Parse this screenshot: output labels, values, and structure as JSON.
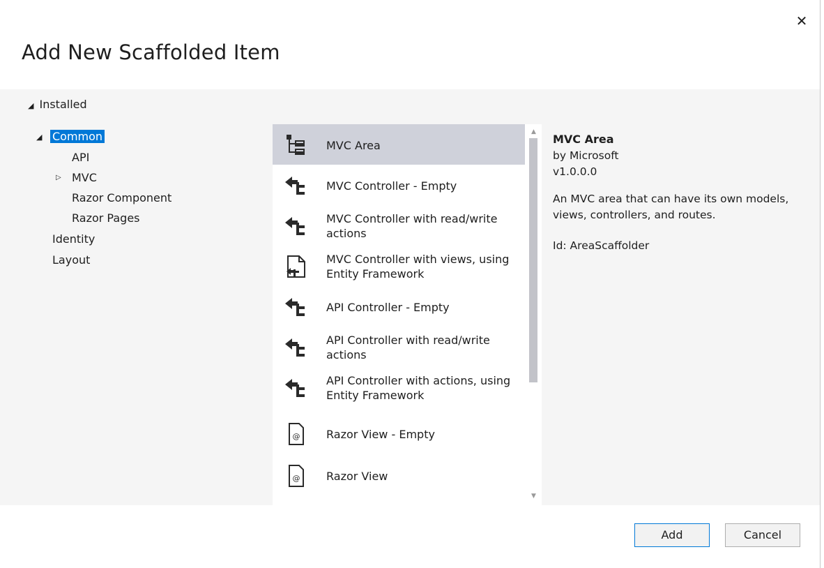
{
  "dialog": {
    "title": "Add New Scaffolded Item",
    "close_label": "✕"
  },
  "tree": {
    "installed_label": "Installed",
    "common_label": "Common",
    "items": [
      {
        "label": "API"
      },
      {
        "label": "MVC"
      },
      {
        "label": "Razor Component"
      },
      {
        "label": "Razor Pages"
      },
      {
        "label": "Identity"
      },
      {
        "label": "Layout"
      }
    ]
  },
  "templates": [
    {
      "line1": "MVC Area",
      "line2": "",
      "icon": "area-icon",
      "selected": true
    },
    {
      "line1": "MVC Controller - Empty",
      "line2": "",
      "icon": "controller-icon"
    },
    {
      "line1": "MVC Controller with read/write",
      "line2": "actions",
      "icon": "controller-icon"
    },
    {
      "line1": "MVC Controller with views, using",
      "line2": "Entity Framework",
      "icon": "controller-views-icon"
    },
    {
      "line1": "API Controller - Empty",
      "line2": "",
      "icon": "controller-icon"
    },
    {
      "line1": "API Controller with read/write",
      "line2": "actions",
      "icon": "controller-icon"
    },
    {
      "line1": "API Controller with actions, using",
      "line2": "Entity Framework",
      "icon": "controller-icon"
    },
    {
      "line1": "Razor View - Empty",
      "line2": "",
      "icon": "razor-view-icon"
    },
    {
      "line1": "Razor View",
      "line2": "",
      "icon": "razor-view-icon"
    }
  ],
  "details": {
    "title": "MVC Area",
    "author": "by Microsoft",
    "version": "v1.0.0.0",
    "description": "An MVC area that can have its own models, views, controllers, and routes.",
    "id": "Id: AreaScaffolder"
  },
  "buttons": {
    "add": "Add",
    "cancel": "Cancel"
  },
  "colors": {
    "accent": "#0078d7",
    "selected_row": "#cfd1da",
    "body_background": "#f5f5f5"
  }
}
